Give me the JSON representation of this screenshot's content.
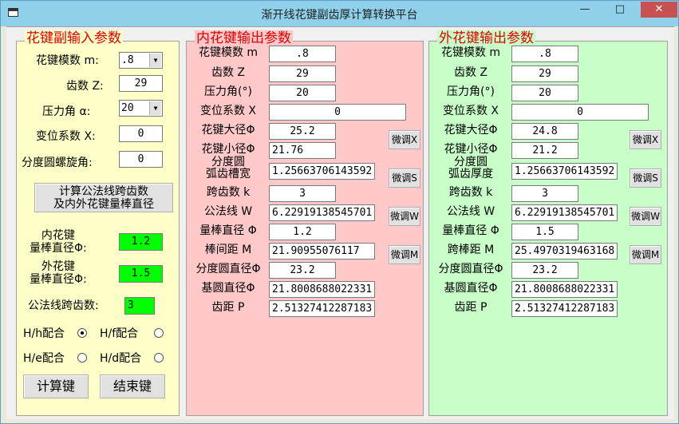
{
  "window": {
    "title": "渐开线花键副齿厚计算转换平台",
    "minimize": "—",
    "maximize": "□",
    "close": "✕"
  },
  "colors": {
    "left_panel": "#ffffc8",
    "inner_panel": "#ffc9c9",
    "outer_panel": "#c8ffc8",
    "result_box": "#00ff00",
    "title_red": "#e00000"
  },
  "left": {
    "title": "花键副输入参数",
    "module_label": "花键模数 m:",
    "module_value": ".8",
    "teeth_label": "齿数 Z:",
    "teeth_value": "29",
    "pressure_label": "压力角 α:",
    "pressure_value": "20",
    "shift_label": "变位系数 X:",
    "shift_value": "0",
    "helix_label": "分度圆螺旋角:",
    "helix_value": "0",
    "calc_btn": "计算公法线跨齿数\n及内外花键量棒直径",
    "inner_rod_label": "内花键\n量棒直径Φ:",
    "inner_rod_value": "1.2",
    "outer_rod_label": "外花键\n量棒直径Φ:",
    "outer_rod_value": "1.5",
    "span_label": "公法线跨齿数:",
    "span_value": "3",
    "fit_hh": "H/h配合",
    "fit_hf": "H/f配合",
    "fit_he": "H/e配合",
    "fit_hd": "H/d配合",
    "compute_btn": "计算键",
    "end_btn": "结束键"
  },
  "inner": {
    "title": "内花键输出参数",
    "rows": [
      {
        "label": "花键模数 m",
        "value": ".8"
      },
      {
        "label": "齿数 Z",
        "value": "29"
      },
      {
        "label": "压力角(°)",
        "value": "20"
      },
      {
        "label": "变位系数 X",
        "value": "0"
      },
      {
        "label": "花键大径Φ",
        "value": "25.2"
      },
      {
        "label": "花键小径Φ",
        "value": "21.76"
      },
      {
        "label": "分度圆\n弧齿槽宽",
        "value": "1.25663706143592"
      },
      {
        "label": "跨齿数 k",
        "value": "3"
      },
      {
        "label": "公法线 W",
        "value": "6.22919138545701"
      },
      {
        "label": "量棒直径 Φ",
        "value": "1.2"
      },
      {
        "label": "棒间距 M",
        "value": "21.90955076117"
      },
      {
        "label": "分度圆直径Φ",
        "value": "23.2"
      },
      {
        "label": "基圆直径Φ",
        "value": "21.8008688022331"
      },
      {
        "label": "齿距 P",
        "value": "2.51327412287183"
      }
    ],
    "btn_x": "微调X",
    "btn_s": "微调S",
    "btn_w": "微调W",
    "btn_m": "微调M"
  },
  "outer": {
    "title": "外花键输出参数",
    "rows": [
      {
        "label": "花键模数 m",
        "value": ".8"
      },
      {
        "label": "齿数 Z",
        "value": "29"
      },
      {
        "label": "压力角(°)",
        "value": "20"
      },
      {
        "label": "变位系数 X",
        "value": "0"
      },
      {
        "label": "花键大径Φ",
        "value": "24.8"
      },
      {
        "label": "花键小径Φ",
        "value": "21.2"
      },
      {
        "label": "分度圆\n弧齿厚度",
        "value": "1.25663706143592"
      },
      {
        "label": "跨齿数 k",
        "value": "3"
      },
      {
        "label": "公法线 W",
        "value": "6.22919138545701"
      },
      {
        "label": "量棒直径 Φ",
        "value": "1.5"
      },
      {
        "label": "跨棒距 M",
        "value": "25.4970319463168"
      },
      {
        "label": "分度圆直径Φ",
        "value": "23.2"
      },
      {
        "label": "基圆直径Φ",
        "value": "21.8008688022331"
      },
      {
        "label": "齿距 P",
        "value": "2.51327412287183"
      }
    ],
    "btn_x": "微调X",
    "btn_s": "微调S",
    "btn_w": "微调W",
    "btn_m": "微调M"
  }
}
